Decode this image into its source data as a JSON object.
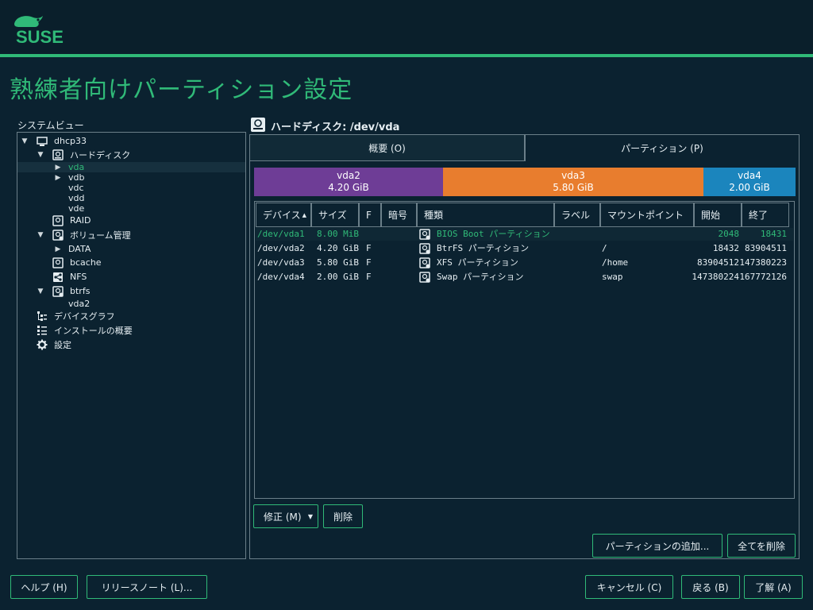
{
  "header": {
    "brand": "SUSE"
  },
  "page": {
    "title": "熟練者向けパーティション設定"
  },
  "system_view": {
    "label": "システムビュー",
    "items": [
      {
        "label": "dhcp33",
        "icon": "computer-icon",
        "expanded": true
      },
      {
        "label": "ハードディスク",
        "icon": "harddisk-icon",
        "expanded": true
      },
      {
        "label": "vda",
        "selected": true
      },
      {
        "label": "vdb"
      },
      {
        "label": "vdc"
      },
      {
        "label": "vdd"
      },
      {
        "label": "vde"
      },
      {
        "label": "RAID",
        "icon": "raid-icon"
      },
      {
        "label": "ボリューム管理",
        "icon": "volume-icon",
        "expanded": true
      },
      {
        "label": "DATA"
      },
      {
        "label": "bcache",
        "icon": "bcache-icon"
      },
      {
        "label": "NFS",
        "icon": "nfs-icon"
      },
      {
        "label": "btrfs",
        "icon": "btrfs-icon",
        "expanded": true
      },
      {
        "label": "vda2"
      },
      {
        "label": "デバイスグラフ",
        "icon": "device-graph-icon"
      },
      {
        "label": "インストールの概要",
        "icon": "list-icon"
      },
      {
        "label": "設定",
        "icon": "gear-icon"
      }
    ]
  },
  "disk": {
    "title": "ハードディスク: /dev/vda",
    "tabs": [
      {
        "label": "概要 (O)"
      },
      {
        "label": "パーティション (P)"
      }
    ],
    "active_tab": 1,
    "bar": [
      {
        "name": "vda2",
        "size": "4.20 GiB",
        "color": "#6e3d96",
        "fraction": 0.42
      },
      {
        "name": "vda3",
        "size": "5.80 GiB",
        "color": "#e87d2e",
        "fraction": 0.58
      },
      {
        "name": "vda4",
        "size": "2.00 GiB",
        "color": "#1b85bd",
        "fraction": 0.2
      }
    ],
    "columns": [
      "デバイス",
      "サイズ",
      "F",
      "暗号",
      "種類",
      "ラベル",
      "マウントポイント",
      "開始",
      "終了"
    ],
    "sort_indicator": "▲",
    "rows": [
      {
        "device": "/dev/vda1",
        "size": "8.00 MiB",
        "f": "",
        "enc": "",
        "type": "BIOS Boot パーティション",
        "label": "",
        "mount": "",
        "start": "2048",
        "end": "18431"
      },
      {
        "device": "/dev/vda2",
        "size": "4.20 GiB",
        "f": "F",
        "enc": "",
        "type": "BtrFS パーティション",
        "label": "",
        "mount": "/",
        "start": "18432",
        "end": "83904511"
      },
      {
        "device": "/dev/vda3",
        "size": "5.80 GiB",
        "f": "F",
        "enc": "",
        "type": "XFS パーティション",
        "label": "",
        "mount": "/home",
        "start": "83904512",
        "end": "147380223"
      },
      {
        "device": "/dev/vda4",
        "size": "2.00 GiB",
        "f": "F",
        "enc": "",
        "type": "Swap パーティション",
        "label": "",
        "mount": "swap",
        "start": "147380224",
        "end": "167772126"
      }
    ]
  },
  "buttons": {
    "modify": "修正 (M)",
    "delete": "削除",
    "add_partition": "パーティションの追加...",
    "delete_all": "全てを削除",
    "help": "ヘルプ (H)",
    "release_notes": "リリースノート (L)...",
    "cancel": "キャンセル (C)",
    "back": "戻る (B)",
    "ok": "了解 (A)"
  },
  "colors": {
    "accent": "#30ba78",
    "background": "#0b2230"
  }
}
